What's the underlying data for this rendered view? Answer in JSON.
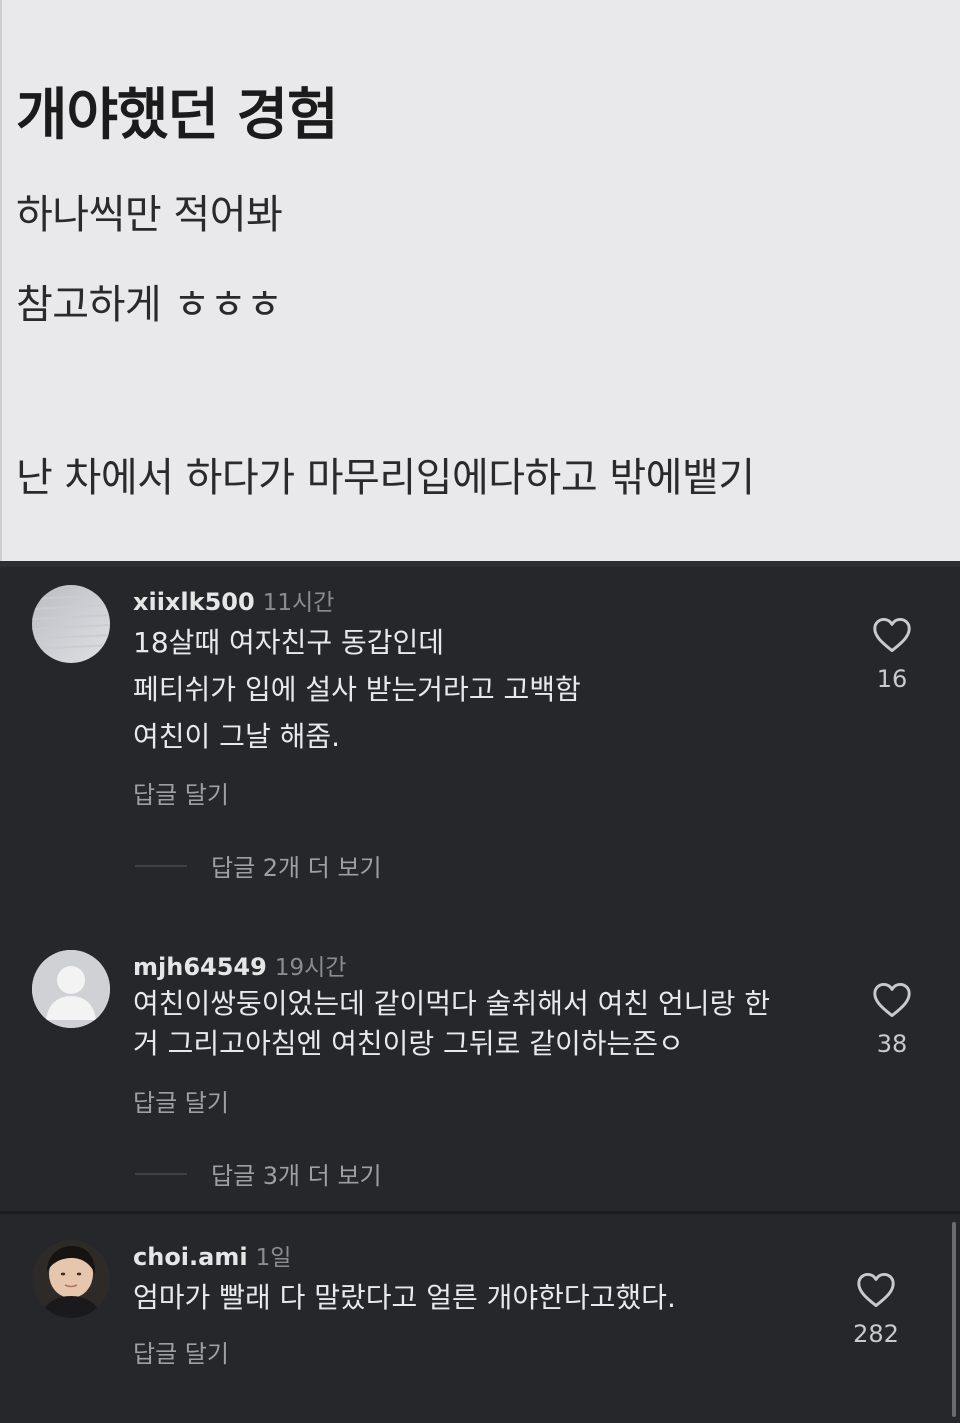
{
  "post": {
    "title": "개야했던 경험",
    "lines": [
      "하나씩만 적어봐",
      "참고하게 ㅎㅎㅎ",
      "난 차에서 하다가 마무리입에다하고 밖에뱉기"
    ]
  },
  "comments": [
    {
      "username": "xiixlk500",
      "time": "11시간",
      "lines": [
        "18살때 여자친구 동갑인데",
        "페티쉬가 입에 설사 받는거라고 고백함",
        "여친이 그날 해줌."
      ],
      "reply_label": "답글 달기",
      "more_replies": "답글 2개 더 보기",
      "likes": "16"
    },
    {
      "username": "mjh64549",
      "time": "19시간",
      "lines": [
        "여친이쌍둥이었는데 같이먹다 술취해서 여친 언니랑 한",
        "거 그리고아침엔 여친이랑 그뒤로 같이하는즌ㅇ"
      ],
      "reply_label": "답글 달기",
      "more_replies": "답글 3개 더 보기",
      "likes": "38"
    },
    {
      "username": "choi.ami",
      "time": "1일",
      "lines": [
        "엄마가 빨래 다 말랐다고 얼른 개야한다고했다."
      ],
      "reply_label": "답글 달기",
      "likes": "282"
    }
  ]
}
